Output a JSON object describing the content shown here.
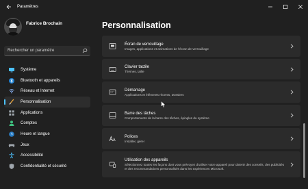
{
  "window": {
    "title": "Paramètres"
  },
  "profile": {
    "name": "Fabrice Brochain"
  },
  "search": {
    "placeholder": "Rechercher un paramètre"
  },
  "nav": {
    "items": [
      {
        "label": "Système",
        "icon": "monitor-icon",
        "color": "#4cc2ff"
      },
      {
        "label": "Bluetooth et appareils",
        "icon": "bluetooth-icon",
        "color": "#4cc2ff"
      },
      {
        "label": "Réseau et Internet",
        "icon": "network-icon",
        "color": "#8ab4f8"
      },
      {
        "label": "Personnalisation",
        "icon": "brush-icon",
        "color": "#e8a33c",
        "active": true
      },
      {
        "label": "Applications",
        "icon": "apps-icon",
        "color": "#9fa6ad"
      },
      {
        "label": "Comptes",
        "icon": "account-icon",
        "color": "#3fbf7f"
      },
      {
        "label": "Heure et langue",
        "icon": "clock-globe-icon",
        "color": "#4cc2ff"
      },
      {
        "label": "Jeux",
        "icon": "gamepad-icon",
        "color": "#9fa6ad"
      },
      {
        "label": "Accessibilité",
        "icon": "accessibility-icon",
        "color": "#4cc2ff"
      },
      {
        "label": "Confidentialité et sécurité",
        "icon": "shield-icon",
        "color": "#9fa6ad"
      }
    ]
  },
  "main": {
    "title": "Personnalisation",
    "cards": [
      {
        "title": "Écran de verrouillage",
        "desc": "Images, applications et animations de l'écran de verrouillage",
        "icon": "lock-screen-icon"
      },
      {
        "title": "Clavier tactile",
        "desc": "Thèmes, taille",
        "icon": "keyboard-icon"
      },
      {
        "title": "Démarrage",
        "desc": "Applications et éléments récents, Dossiers",
        "icon": "start-menu-icon"
      },
      {
        "title": "Barre des tâches",
        "desc": "Comportements de la barre des tâches, épingles du système",
        "icon": "taskbar-icon"
      },
      {
        "title": "Polices",
        "desc": "Installer, gérer",
        "icon": "fonts-icon"
      },
      {
        "title": "Utilisation des appareils",
        "desc": "Sélectionnez toutes les façons dont vous prévoyez d'utiliser votre appareil pour obtenir des conseils, des publicités et des recommandations personnalisés dans les expériences Microsoft.",
        "icon": "device-usage-icon"
      }
    ]
  },
  "colors": {
    "background": "#202020",
    "card": "#2b2b2b",
    "accent": "#4cc2ff"
  }
}
